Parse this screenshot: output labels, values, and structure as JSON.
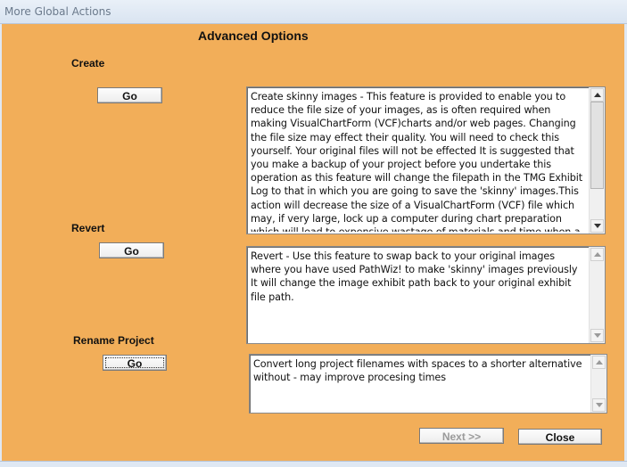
{
  "window": {
    "title": "More Global Actions"
  },
  "page": {
    "heading": "Advanced Options"
  },
  "sections": {
    "create": {
      "label": "Create",
      "button": "Go",
      "description": "Create skinny images - This feature is provided to enable you to reduce the file size of your images, as is often required when making VisualChartForm (VCF)charts and/or web pages. Changing the file size may effect their quality. You will need to check this yourself.  Your original files will not be effected It is suggested that you make a backup of your project before you undertake this operation as this feature will change the filepath in the TMG Exhibit Log to that in which you are going to save the 'skinny' images.This action will decrease the size of a VisualChartForm (VCF) file which may, if very large, lock up a computer during chart preparation which will lead to expensive wastage of materials and time when a chart needs to be split up to"
    },
    "revert": {
      "label": "Revert",
      "button": "Go",
      "description": "Revert - Use this feature to swap back to your original images where you have used PathWiz! to make 'skinny' images previously  It will change the image exhibit path back to your original exhibit file path."
    },
    "rename": {
      "label": "Rename Project",
      "button": "Go",
      "description": "Convert long project filenames with spaces to a shorter alternative without - may improve procesing times"
    }
  },
  "footer": {
    "next_label": "Next >>",
    "close_label": "Close"
  }
}
